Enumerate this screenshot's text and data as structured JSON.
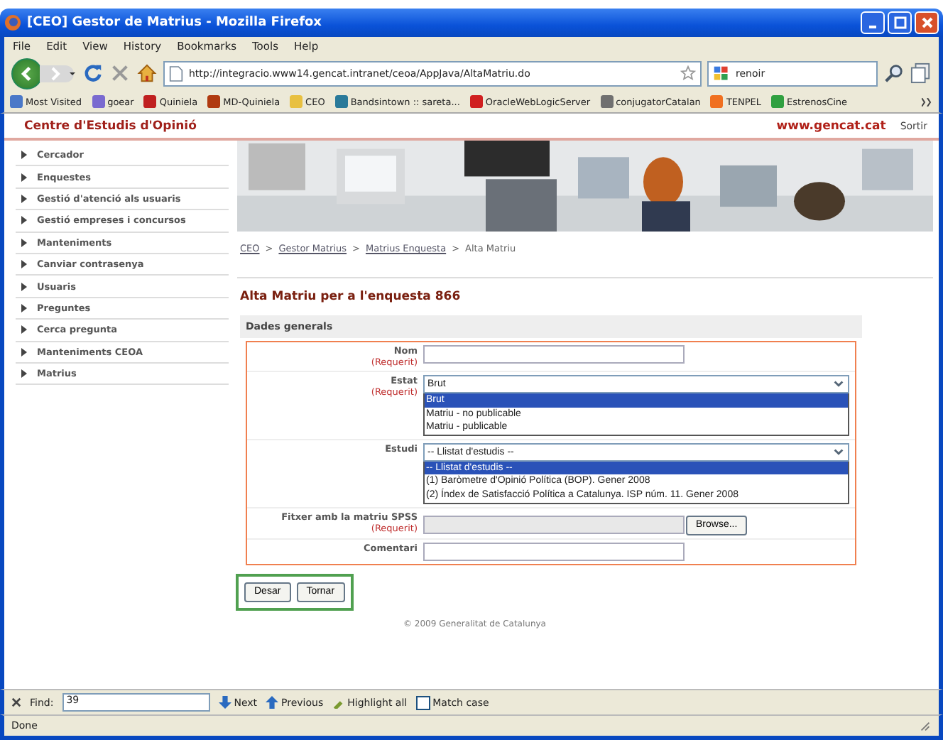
{
  "window": {
    "title": "[CEO] Gestor de Matrius - Mozilla Firefox"
  },
  "menu": [
    "File",
    "Edit",
    "View",
    "History",
    "Bookmarks",
    "Tools",
    "Help"
  ],
  "toolbar": {
    "url": "http://integracio.www14.gencat.intranet/ceoa/AppJava/AltaMatriu.do",
    "search_value": "renoir"
  },
  "bookmarks": [
    {
      "label": "Most Visited",
      "color": "#4a78c8"
    },
    {
      "label": "goear",
      "color": "#7a6ad0"
    },
    {
      "label": "Quiniela",
      "color": "#c02020"
    },
    {
      "label": "MD-Quiniela",
      "color": "#b03a10"
    },
    {
      "label": "CEO",
      "color": "#e8c040"
    },
    {
      "label": "Bandsintown :: sareta...",
      "color": "#2a7a9a"
    },
    {
      "label": "OracleWebLogicServer",
      "color": "#d02020"
    },
    {
      "label": "conjugatorCatalan",
      "color": "#707070"
    },
    {
      "label": "TENPEL",
      "color": "#f07020"
    },
    {
      "label": "EstrenosCine",
      "color": "#30a040"
    }
  ],
  "site": {
    "name": "Centre d'Estudis d'Opinió",
    "domain": "www.gencat.cat",
    "logout": "Sortir"
  },
  "sidebar": [
    "Cercador",
    "Enquestes",
    "Gestió d'atenció als usuaris",
    "Gestió empreses i concursos",
    "Manteniments",
    "Canviar contrasenya",
    "Usuaris",
    "Preguntes",
    "Cerca pregunta",
    "Manteniments CEOA",
    "Matrius"
  ],
  "breadcrumb": [
    {
      "label": "CEO",
      "link": true
    },
    {
      "separator": ">",
      "label": "Gestor Matrius",
      "link": true
    },
    {
      "separator": ">",
      "label": "Matrius Enquesta",
      "link": true
    },
    {
      "separator": ">",
      "label": "Alta Matriu",
      "link": false
    }
  ],
  "heading": "Alta Matriu per a l'enquesta 866",
  "section_title": "Dades generals",
  "form": [
    {
      "kind": "text",
      "label": "Nom",
      "required": "(Requerit)"
    },
    {
      "kind": "select",
      "label": "Estat",
      "required": "(Requerit)",
      "value": "Brut",
      "expanded": true,
      "options": [
        {
          "label": "Brut",
          "selected": true
        },
        {
          "label": "Matriu - no publicable",
          "selected": false
        },
        {
          "label": "Matriu - publicable",
          "selected": false
        }
      ]
    },
    {
      "kind": "select",
      "label": "Estudi",
      "value": "-- Llistat d'estudis --",
      "expanded": true,
      "options": [
        {
          "label": "-- Llistat d'estudis --",
          "selected": true
        },
        {
          "label": "(1) Baròmetre d'Opinió Política (BOP). Gener 2008",
          "selected": false
        },
        {
          "label": "(2) Índex de Satisfacció Política a Catalunya. ISP núm. 11. Gener 2008",
          "selected": false
        }
      ]
    },
    {
      "kind": "file",
      "label": "Fitxer amb la matriu SPSS",
      "required": "(Requerit)",
      "button": "Browse..."
    },
    {
      "kind": "text",
      "label": "Comentari"
    }
  ],
  "buttons": [
    "Desar",
    "Tornar"
  ],
  "footer": "© 2009 Generalitat de Catalunya",
  "find_bar": {
    "label": "Find:",
    "value": "39",
    "next": "Next",
    "previous": "Previous",
    "highlight": "Highlight all",
    "match_case": {
      "label": "Match case",
      "checked": false
    }
  },
  "status": "Done"
}
